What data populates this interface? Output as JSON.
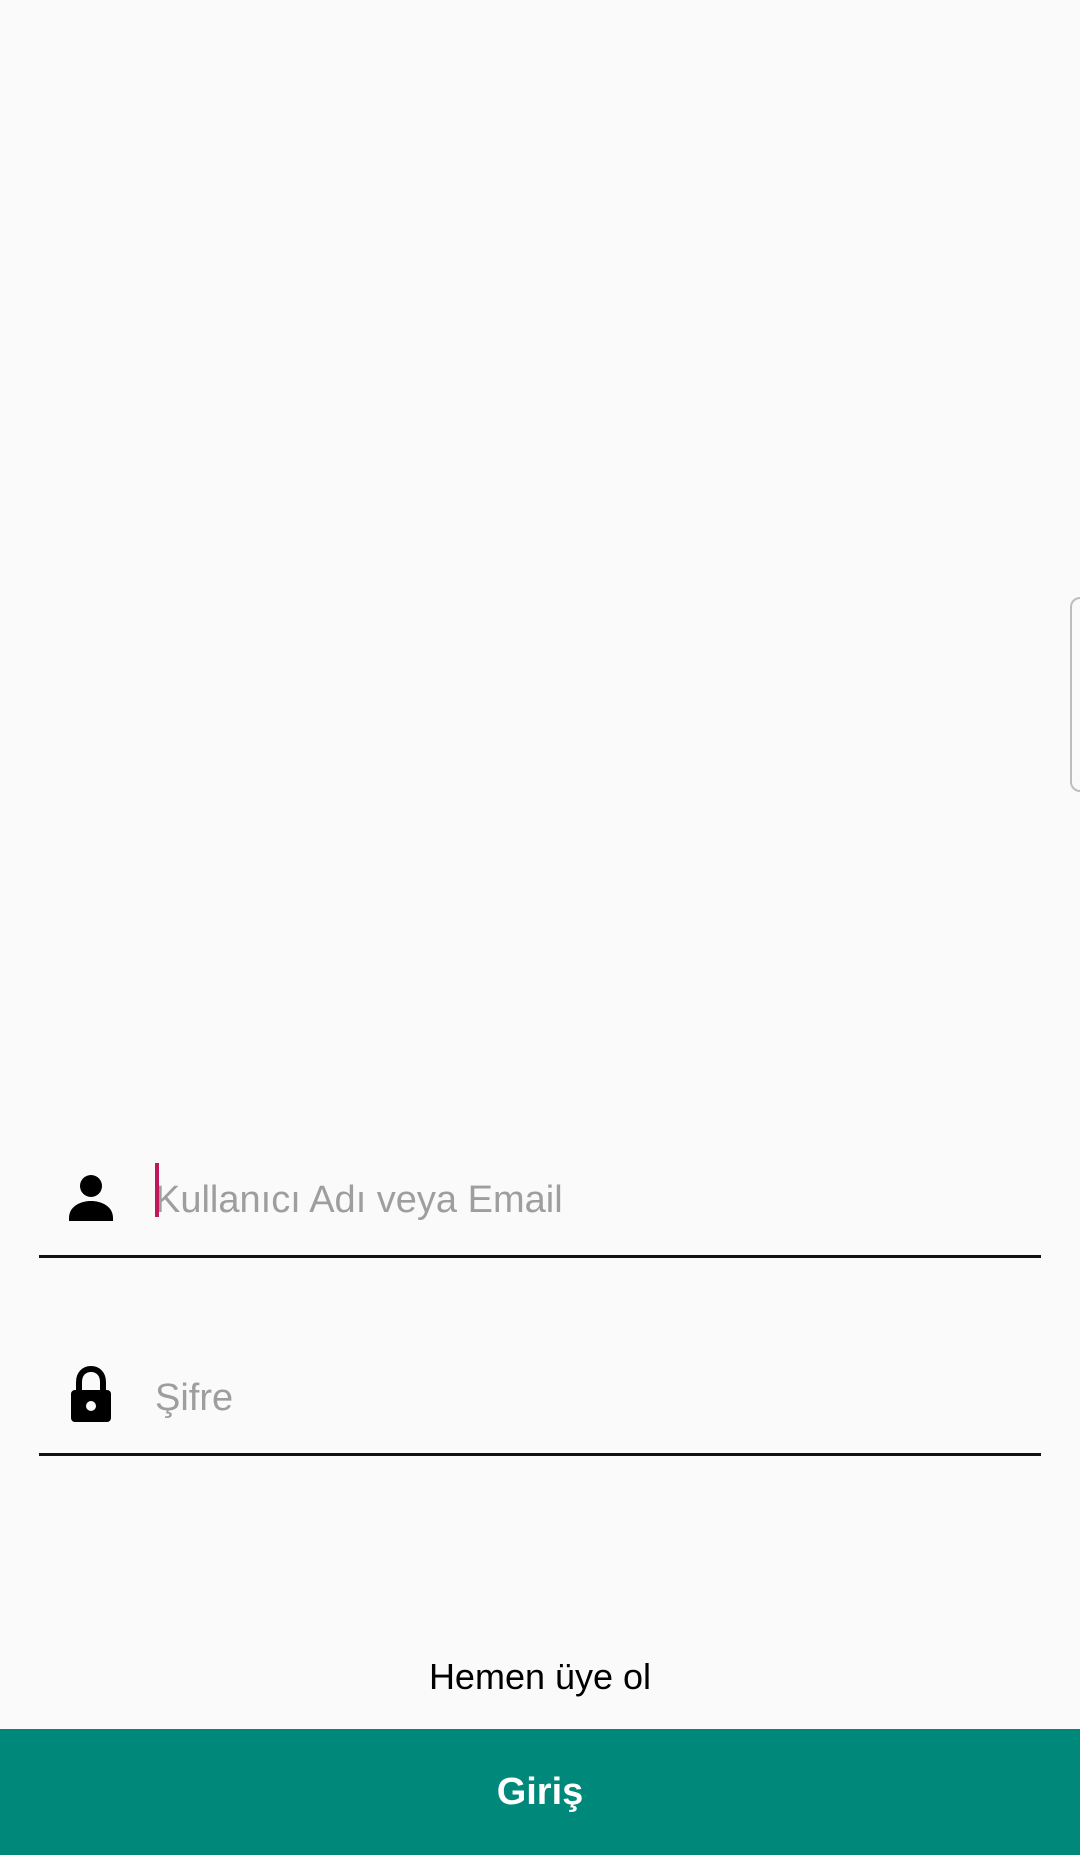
{
  "login_form": {
    "username": {
      "placeholder": "Kullanıcı Adı veya Email",
      "value": "",
      "icon": "person-icon"
    },
    "password": {
      "placeholder": "Şifre",
      "value": "",
      "icon": "lock-icon"
    },
    "signup_link": "Hemen üye ol",
    "login_button": "Giriş"
  },
  "colors": {
    "background": "#fafafa",
    "primary": "#00897b",
    "caret": "#c2185b",
    "placeholder": "#9e9e9e"
  }
}
